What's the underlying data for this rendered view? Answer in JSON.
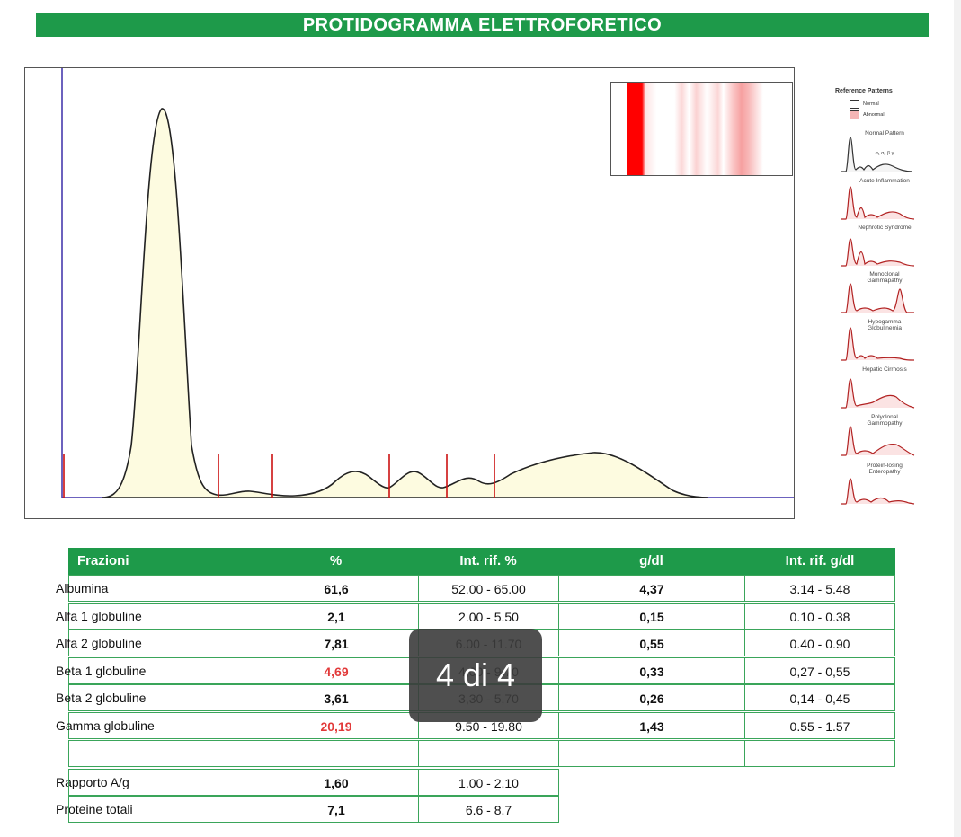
{
  "title": "PROTIDOGRAMMA ELETTROFORETICO",
  "reference_patterns": {
    "title": "Reference Patterns",
    "legend": {
      "normal": "Normal",
      "abnormal": "Abnormal"
    },
    "items": [
      {
        "label": "Normal Pattern",
        "sub": "α₁ α₂  β    γ"
      },
      {
        "label": "Acute Inflammation"
      },
      {
        "label": "Nephrotic Syndrome"
      },
      {
        "label": "Monoclonal Gammapathy"
      },
      {
        "label": "Hypogamma Globulinemia"
      },
      {
        "label": "Hepatic Cirrhosis"
      },
      {
        "label": "Polyclonal Gammopathy"
      },
      {
        "label": "Protein-losing Enteropathy"
      }
    ]
  },
  "table": {
    "headers": [
      "Frazioni",
      "%",
      "Int. rif. %",
      "g/dl",
      "Int. rif. g/dl"
    ],
    "rows": [
      {
        "name": "Albumina",
        "pct": "61,6",
        "ref_pct": "52.00 - 65.00",
        "gdl": "4,37",
        "ref_gdl": "3.14 - 5.48",
        "flag": false
      },
      {
        "name": "Alfa 1 globuline",
        "pct": "2,1",
        "ref_pct": "2.00 - 5.50",
        "gdl": "0,15",
        "ref_gdl": "0.10 - 0.38",
        "flag": false
      },
      {
        "name": "Alfa 2 globuline",
        "pct": "7,81",
        "ref_pct": "6.00 - 11.70",
        "gdl": "0,55",
        "ref_gdl": "0.40 - 0.90",
        "flag": false
      },
      {
        "name": "Beta 1 globuline",
        "pct": "4,69",
        "ref_pct": "4,00 - 9,70",
        "gdl": "0,33",
        "ref_gdl": "0,27 - 0,55",
        "flag": true
      },
      {
        "name": "Beta 2 globuline",
        "pct": "3,61",
        "ref_pct": "3,30 - 5,70",
        "gdl": "0,26",
        "ref_gdl": "0,14 - 0,45",
        "flag": false
      },
      {
        "name": "Gamma globuline",
        "pct": "20,19",
        "ref_pct": "9.50 - 19.80",
        "gdl": "1,43",
        "ref_gdl": "0.55 - 1.57",
        "flag": true
      }
    ],
    "ratio": {
      "name": "Rapporto A/g",
      "value": "1,60",
      "ref": "1.00 - 2.10"
    },
    "total": {
      "name": "Proteine totali",
      "value": "7,1",
      "ref": "6.6 - 8.7"
    }
  },
  "overlay": {
    "text": "4 di 4"
  },
  "colors": {
    "header_green": "#1e9a4a",
    "curve_fill": "#fdfbe0",
    "marker_red": "#cc1111",
    "axis_blue": "#3b2fa8",
    "flag_red": "#e23a3a"
  }
}
